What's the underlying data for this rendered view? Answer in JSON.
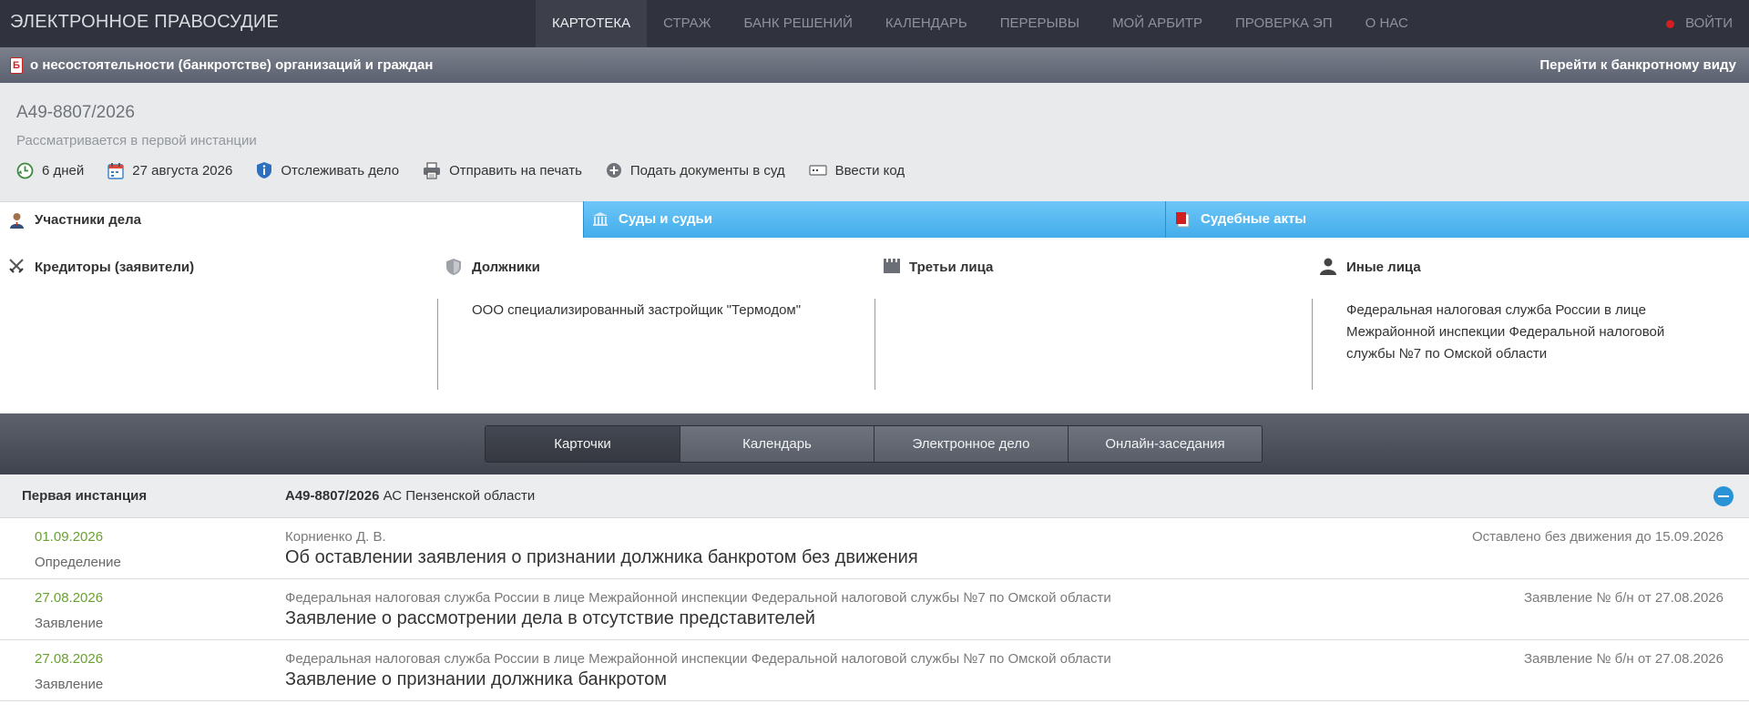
{
  "app": {
    "brand": "ЭЛЕКТРОННОЕ ПРАВОСУДИЕ",
    "nav": [
      "КАРТОТЕКА",
      "СТРАЖ",
      "БАНК РЕШЕНИЙ",
      "КАЛЕНДАРЬ",
      "ПЕРЕРЫВЫ",
      "МОЙ АРБИТР",
      "ПРОВЕРКА ЭП",
      "О НАС"
    ],
    "login": "ВОЙТИ"
  },
  "bankruptcy": {
    "icon_letter": "Б",
    "title": "о несостоятельности (банкротстве) организаций и граждан",
    "link": "Перейти к банкротному виду"
  },
  "case": {
    "number": "А49-8807/2026",
    "status": "Рассматривается в первой инстанции",
    "tools": {
      "days": "6 дней",
      "date": "27 августа 2026",
      "track": "Отслеживать дело",
      "print": "Отправить на печать",
      "submit": "Подать документы в суд",
      "code": "Ввести код"
    }
  },
  "tabs": [
    "Участники дела",
    "Суды и судьи",
    "Судебные акты"
  ],
  "participants": {
    "creditors": {
      "title": "Кредиторы (заявители)",
      "items": ""
    },
    "debtors": {
      "title": "Должники",
      "items": "ООО специализированный застройщик \"Термодом\""
    },
    "third": {
      "title": "Третьи лица",
      "items": ""
    },
    "other": {
      "title": "Иные лица",
      "items": "Федеральная налоговая служба России в лице Межрайонной инспекции Федеральной налоговой службы №7 по Омской области"
    }
  },
  "subtabs": [
    "Карточки",
    "Календарь",
    "Электронное дело",
    "Онлайн-заседания"
  ],
  "instance": {
    "label": "Первая инстанция",
    "case_number": "А49-8807/2026",
    "court": "АС Пензенской области"
  },
  "documents": [
    {
      "date": "01.09.2026",
      "type": "Определение",
      "author": "Корниенко Д. В.",
      "title": "Об оставлении заявления о признании должника банкротом без движения",
      "note": "Оставлено без движения до 15.09.2026"
    },
    {
      "date": "27.08.2026",
      "type": "Заявление",
      "author": "Федеральная налоговая служба России в лице Межрайонной инспекции Федеральной налоговой службы №7 по Омской области",
      "title": "Заявление о рассмотрении дела в отсутствие представителей",
      "note": "Заявление № б/н от 27.08.2026"
    },
    {
      "date": "27.08.2026",
      "type": "Заявление",
      "author": "Федеральная налоговая служба России в лице Межрайонной инспекции Федеральной налоговой службы №7 по Омской области",
      "title": "Заявление о признании должника банкротом",
      "note": "Заявление № б/н от 27.08.2026"
    }
  ],
  "colors": {
    "topbar": "#30333d",
    "tab_blue": "#42adeb",
    "date_green": "#6aa032",
    "login_dot": "#d21f1f",
    "collapse_blue": "#2a93d5"
  }
}
